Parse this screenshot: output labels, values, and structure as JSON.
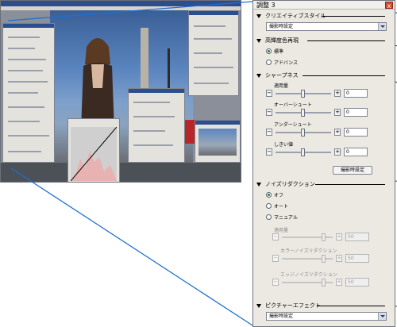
{
  "panel": {
    "title": "調整 3",
    "close_symbol": "x"
  },
  "sections": {
    "creative_style": {
      "header": "クリエイティブスタイル",
      "dropdown_value": "撮影時設定"
    },
    "color_gamut": {
      "header": "高輝度色再現",
      "options": [
        "標準",
        "アドバンス"
      ],
      "selected": "標準"
    },
    "sharpness": {
      "header": "シャープネス",
      "sliders": [
        {
          "label": "適用量",
          "value": "0"
        },
        {
          "label": "オーバーシュート",
          "value": "0"
        },
        {
          "label": "アンダーシュート",
          "value": "0"
        },
        {
          "label": "しきい値",
          "value": "0"
        }
      ],
      "button_label": "撮影時設定"
    },
    "noise_reduction": {
      "header": "ノイズリダクション",
      "options": [
        "オフ",
        "オート",
        "マニュアル"
      ],
      "selected": "オフ",
      "amount_label": "適用量",
      "amount_value": "50",
      "color_label": "カラーノイズリダクション",
      "color_value": "50",
      "edge_label": "エッジノイズリダクション",
      "edge_value": "50"
    },
    "picture_effect": {
      "header": "ピクチャーエフェクト",
      "dropdown_value": "撮影時設定"
    }
  },
  "icons": {
    "section_toggle": "triangle-down-icon",
    "dropdown_arrow": "chevron-down-icon",
    "decrement": "minus-icon",
    "increment": "plus-icon"
  },
  "colors": {
    "accent_title": "#2b4e8c",
    "close_button": "#d84a2f",
    "radio_selected": "#2b7a2b",
    "connector_line": "#1f6fd0"
  }
}
